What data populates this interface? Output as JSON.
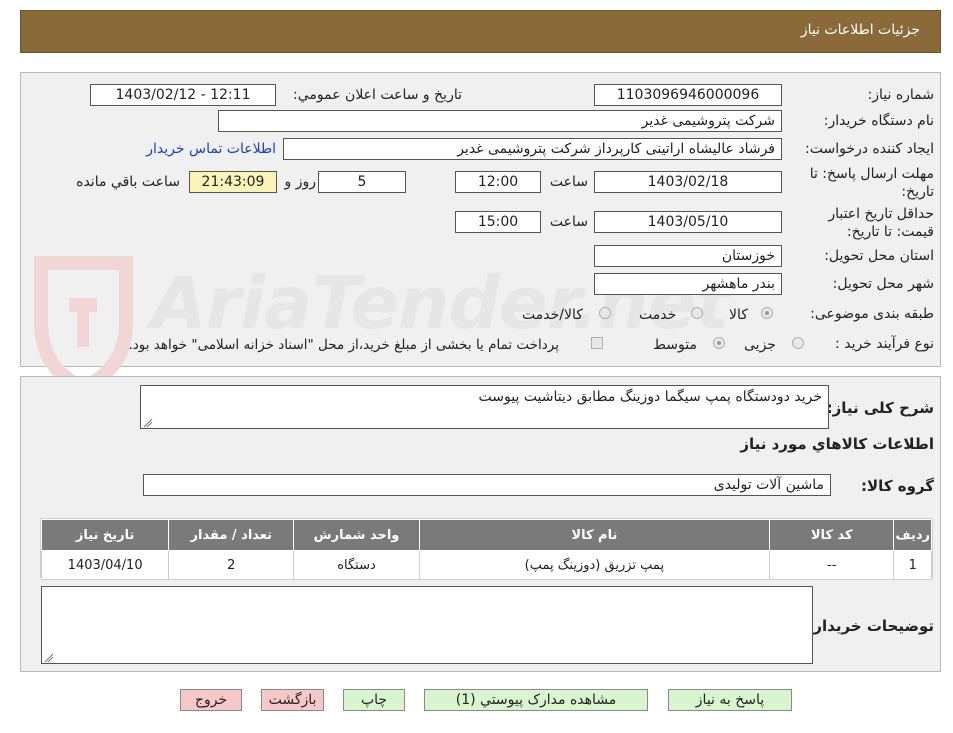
{
  "header": {
    "title": "جزئیات اطلاعات نیاز"
  },
  "watermark": {
    "text": "AriaTender.net"
  },
  "form": {
    "need_number_label": "شماره نیاز:",
    "need_number": "1103096946000096",
    "announce_label": "تاریخ و ساعت اعلان عمومي:",
    "announce_value": "1403/02/12 - 12:11",
    "buyer_org_label": "نام دستگاه خريدار:",
    "buyer_org": "شرکت پتروشیمی غدیر",
    "requester_label": "ايجاد کننده درخواست:",
    "requester": "فرشاد عالیشاه اراتینی کارپرداز شرکت پتروشیمی غدیر",
    "contact_link": "اطلاعات تماس خريدار",
    "deadline_label_1": "مهلت ارسال پاسخ: تا",
    "deadline_label_2": "تاریخ:",
    "deadline_date": "1403/02/18",
    "time_label": "ساعت",
    "deadline_time": "12:00",
    "days_value": "5",
    "days_label": "روز و",
    "remaining_time": "21:43:09",
    "remaining_label": "ساعت باقي مانده",
    "validity_label_1": "حداقل تاریخ اعتبار",
    "validity_label_2": "قیمت: تا تاریخ:",
    "validity_date": "1403/05/10",
    "validity_time": "15:00",
    "province_label": "استان محل تحویل:",
    "province": "خوزستان",
    "city_label": "شهر محل تحویل:",
    "city": "بندر ماهشهر",
    "category_label": "طبقه بندی موضوعی:",
    "category_options": [
      "کالا",
      "خدمت",
      "کالا/خدمت"
    ],
    "category_selected": "کالا",
    "process_label": "نوع فرآیند خرید :",
    "process_options": [
      "جزیی",
      "متوسط"
    ],
    "process_selected": "متوسط",
    "payment_note": "پرداخت تمام یا بخشی از مبلغ خرید،از محل \"اسناد خزانه اسلامی\" خواهد بود."
  },
  "summary": {
    "title_label": "شرح کلی نیاز:",
    "title_value": "خرید دودستگاه پمپ سیگما دوزینگ مطابق دیتاشیت پیوست",
    "goods_info_heading": "اطلاعات کالاهاي مورد نياز",
    "group_label": "گروه کالا:",
    "group_value": "ماشین آلات تولیدی"
  },
  "table": {
    "headers": [
      "رديف",
      "کد کالا",
      "نام کالا",
      "واحد شمارش",
      "تعداد / مقدار",
      "تاريخ نياز"
    ],
    "rows": [
      [
        "1",
        "--",
        "پمپ تزریق (دوزینگ پمپ)",
        "دستگاه",
        "2",
        "1403/04/10"
      ]
    ]
  },
  "notes": {
    "label": "توضيحات خريدار:",
    "value": ""
  },
  "buttons": {
    "reply": "پاسخ به نياز",
    "attachments": "مشاهده مدارک پيوستي (1)",
    "print": "چاپ",
    "back": "بازگشت",
    "exit": "خروج"
  },
  "colors": {
    "header_bg": "#8b6a3a",
    "table_header_bg": "#7a7a7a",
    "link": "#1a3fc4",
    "highlight": "#fcf3b6",
    "green_button": "#d8f5d0",
    "red_button": "#f8c8c8"
  }
}
